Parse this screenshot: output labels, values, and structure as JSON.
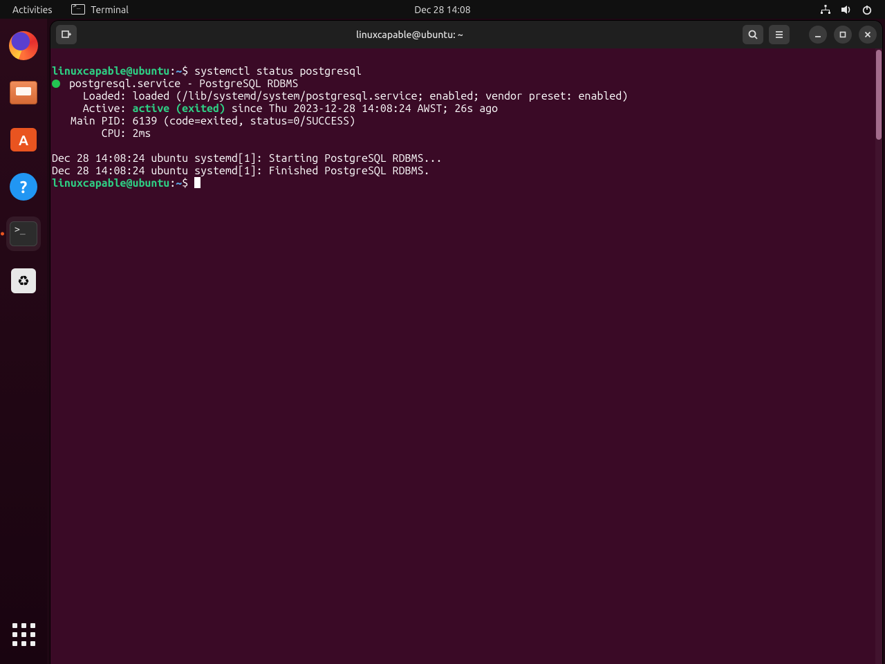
{
  "topbar": {
    "activities": "Activities",
    "running_app": "Terminal",
    "clock": "Dec 28  14:08"
  },
  "dock_apps": [
    {
      "name": "firefox"
    },
    {
      "name": "files"
    },
    {
      "name": "software"
    },
    {
      "name": "help"
    },
    {
      "name": "terminal",
      "active": true
    },
    {
      "name": "trash"
    }
  ],
  "terminal_window": {
    "title": "linuxcapable@ubuntu: ~"
  },
  "terminal": {
    "prompt": {
      "user": "linuxcapable@ubuntu",
      "path": "~",
      "sep1": ":",
      "sep2": "$"
    },
    "command": "systemctl status postgresql",
    "status": {
      "unit_line": " postgresql.service - PostgreSQL RDBMS",
      "loaded": "     Loaded: loaded (/lib/systemd/system/postgresql.service; enabled; vendor preset: enabled)",
      "active_lbl": "     Active: ",
      "active_val": "active (exited)",
      "active_rest": " since Thu 2023-12-28 14:08:24 AWST; 26s ago",
      "main_pid": "   Main PID: 6139 (code=exited, status=0/SUCCESS)",
      "cpu": "        CPU: 2ms",
      "log1": "Dec 28 14:08:24 ubuntu systemd[1]: Starting PostgreSQL RDBMS...",
      "log2": "Dec 28 14:08:24 ubuntu systemd[1]: Finished PostgreSQL RDBMS."
    }
  }
}
